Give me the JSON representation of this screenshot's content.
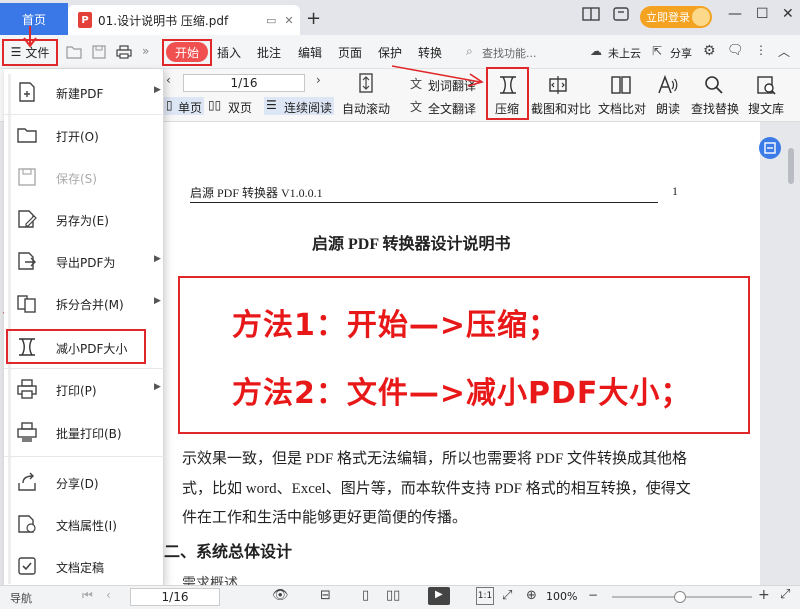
{
  "titlebar": {
    "home_tab": "首页",
    "doc_tab_badge": "P",
    "doc_tab_title": "01.设计说明书 压缩.pdf",
    "new_tab": "+",
    "login": "立即登录"
  },
  "menubar": {
    "file": "文件",
    "start": "开始",
    "items": [
      "插入",
      "批注",
      "编辑",
      "页面",
      "保护",
      "转换"
    ],
    "search_placeholder": "查找功能...",
    "cloud": "未上云",
    "share": "分享"
  },
  "toolbar": {
    "page_indicator": "1/16",
    "single_page": "单页",
    "double_page": "双页",
    "continuous": "连续阅读",
    "auto_scroll": "自动滚动",
    "translate": "划词翻译",
    "full_translate": "全文翻译",
    "compress": "压缩",
    "screenshot_compare": "截图和对比",
    "doc_compare": "文档比对",
    "read_aloud": "朗读",
    "find_replace": "查找替换",
    "search_library": "搜文库"
  },
  "file_menu": [
    {
      "label": "新建PDF",
      "submenu": true,
      "disabled": false,
      "icon": "new-pdf-icon"
    },
    {
      "label": "打开(O)",
      "submenu": false,
      "disabled": false,
      "icon": "folder-open-icon"
    },
    {
      "label": "保存(S)",
      "submenu": false,
      "disabled": true,
      "icon": "save-icon"
    },
    {
      "label": "另存为(E)",
      "submenu": false,
      "disabled": false,
      "icon": "save-as-icon"
    },
    {
      "label": "导出PDF为",
      "submenu": true,
      "disabled": false,
      "icon": "export-icon"
    },
    {
      "label": "拆分合并(M)",
      "submenu": true,
      "disabled": false,
      "icon": "split-merge-icon"
    },
    {
      "label": "减小PDF大小",
      "submenu": false,
      "disabled": false,
      "icon": "compress-icon"
    },
    {
      "label": "打印(P)",
      "submenu": true,
      "disabled": false,
      "icon": "print-icon"
    },
    {
      "label": "批量打印(B)",
      "submenu": false,
      "disabled": false,
      "icon": "batch-print-icon"
    },
    {
      "label": "分享(D)",
      "submenu": false,
      "disabled": false,
      "icon": "share-icon"
    },
    {
      "label": "文档属性(I)",
      "submenu": false,
      "disabled": false,
      "icon": "doc-properties-icon"
    },
    {
      "label": "文档定稿",
      "submenu": false,
      "disabled": false,
      "icon": "finalize-icon"
    }
  ],
  "document": {
    "header_text": "启源 PDF 转换器 V1.0.0.1",
    "header_page": "1",
    "title": "启源 PDF 转换器设计说明书",
    "note_line1": "方法1：开始—>压缩；",
    "note_line2": "方法2：文件—>减小PDF大小；",
    "para_line1": "示效果一致，但是 PDF 格式无法编辑，所以也需要将 PDF 文件转换成其他格",
    "para_line2": "式，比如 word、Excel、图片等，而本软件支持 PDF 格式的相互转换，使得文",
    "para_line3": "件在工作和生活中能够更好更简便的传播。",
    "section_title": "二、系统总体设计",
    "subsection": "需求概述"
  },
  "statusbar": {
    "nav": "导航",
    "page": "1/16",
    "zoom": "100%"
  },
  "colors": {
    "accent_blue": "#3a78e8",
    "start_red": "#f05050",
    "annotation_red": "#e0282a",
    "login_orange": "#f3a321"
  }
}
